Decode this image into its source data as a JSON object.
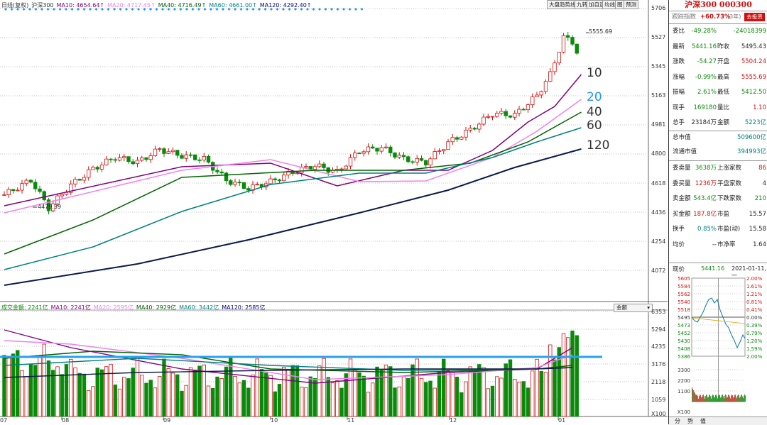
{
  "header": {
    "price_legend_label": "日线(复权)",
    "index_name": "沪深300",
    "ma": [
      {
        "label": "MA10: 4654.64↑",
        "color": "#800080"
      },
      {
        "label": "MA20: 4717.45↑",
        "color": "#ee82ee"
      },
      {
        "label": "MA40: 4716.49↑",
        "color": "#006400"
      },
      {
        "label": "MA60: 4661.00↑",
        "color": "#008080"
      },
      {
        "label": "MA120: 4292.40↑",
        "color": "#000080"
      }
    ],
    "toolbar": [
      "大盘趋势线",
      "九转",
      "加自选",
      "均线",
      "图",
      "预测"
    ]
  },
  "price_axis": [
    "5706",
    "5527",
    "5345",
    "5163",
    "4981",
    "4800",
    "4618",
    "4436",
    "4254",
    "4072"
  ],
  "price_annotations": {
    "high": "5555.69",
    "low": "4479.39"
  },
  "ma_big_labels": [
    {
      "text": "10",
      "color": "#333333"
    },
    {
      "text": "20",
      "color": "#2196f3"
    },
    {
      "text": "40",
      "color": "#333333"
    },
    {
      "text": "60",
      "color": "#333333"
    },
    {
      "text": "120",
      "color": "#333333"
    }
  ],
  "volume": {
    "legend": [
      {
        "label": "成交金额: 2241亿",
        "color": "#0a8a0a"
      },
      {
        "label": "MA10: 2241亿",
        "color": "#800080"
      },
      {
        "label": "MA20: 2595亿",
        "color": "#ee82ee"
      },
      {
        "label": "MA40: 2929亿",
        "color": "#006400"
      },
      {
        "label": "MA60: 3442亿",
        "color": "#008080"
      },
      {
        "label": "MA120: 2585亿",
        "color": "#000080"
      }
    ],
    "mode_button": "金额",
    "axis": [
      "6353",
      "5294",
      "4235",
      "3176",
      "2118",
      "1059"
    ],
    "unit": "X100"
  },
  "x_axis": [
    "07",
    "08",
    "09",
    "10",
    "11",
    "12",
    "01"
  ],
  "sidebar": {
    "title": "沪深300 000300",
    "tracking_label": "跟踪指数",
    "tracking_value": "+60.73%",
    "tracking_period": "(3年)",
    "buy_button": "去投资",
    "rows1": [
      {
        "k": "委比",
        "v1": "-49.28%",
        "c1": "green",
        "k2": "",
        "v2": "-24018399",
        "c2": "green"
      },
      {
        "k": "最新",
        "v1": "5441.16",
        "c1": "green",
        "k2": "昨收",
        "v2": "5495.43",
        "c2": ""
      },
      {
        "k": "涨跌",
        "v1": "-54.27",
        "c1": "green",
        "k2": "开盘",
        "v2": "5504.24",
        "c2": "red"
      },
      {
        "k": "涨幅",
        "v1": "-0.99%",
        "c1": "green",
        "k2": "最高",
        "v2": "5555.69",
        "c2": "red"
      },
      {
        "k": "振幅",
        "v1": "2.61%",
        "c1": "green",
        "k2": "最低",
        "v2": "5412.50",
        "c2": "green"
      },
      {
        "k": "现手",
        "v1": "169180",
        "c1": "green",
        "k2": "量比",
        "v2": "1.10",
        "c2": "red"
      },
      {
        "k": "总手",
        "v1": "23184万",
        "c1": "",
        "k2": "金额",
        "v2": "5223亿",
        "c2": "teal"
      }
    ],
    "cap": [
      {
        "k": "总市值",
        "v": "509600亿"
      },
      {
        "k": "流通市值",
        "v": "394993亿"
      }
    ],
    "rows2": [
      {
        "k": "委卖量",
        "v1": "3638万",
        "c1": "green",
        "k2": "上涨家数",
        "v2": "86",
        "c2": "red"
      },
      {
        "k": "委买量",
        "v1": "1236万",
        "c1": "red",
        "k2": "平盘家数",
        "v2": "4",
        "c2": ""
      },
      {
        "k": "卖金额",
        "v1": "543.4亿",
        "c1": "green",
        "k2": "下跌家数",
        "v2": "210",
        "c2": "green"
      },
      {
        "k": "买金额",
        "v1": "187.8亿",
        "c1": "red",
        "k2": "市盈",
        "v2": "15.57",
        "c2": ""
      },
      {
        "k": "换手",
        "v1": "0.85%",
        "c1": "teal",
        "k2": "市盈(动)",
        "v2": "15.58",
        "c2": ""
      },
      {
        "k": "均价",
        "v1": "--",
        "c1": "",
        "k2": "市净率",
        "v2": "1.64",
        "c2": ""
      }
    ],
    "now_label": "现价",
    "now_value": "5441.16",
    "now_date": "2021-01-11,一",
    "mini_left": [
      "5605",
      "5584",
      "5562",
      "5540",
      "5518",
      "5495",
      "5473",
      "5452",
      "5430",
      "5408",
      "5386"
    ],
    "mini_right": [
      "2.00%",
      "1.61%",
      "1.21%",
      "0.81%",
      "0.41%",
      "0.00%",
      "0.39%",
      "0.79%",
      "1.20%",
      "1.59%",
      "2.00%"
    ],
    "mini_vol": [
      "3300",
      "2200",
      "1100"
    ],
    "mini_unit": "X100",
    "tabs": [
      "分",
      "势",
      "值"
    ]
  }
}
